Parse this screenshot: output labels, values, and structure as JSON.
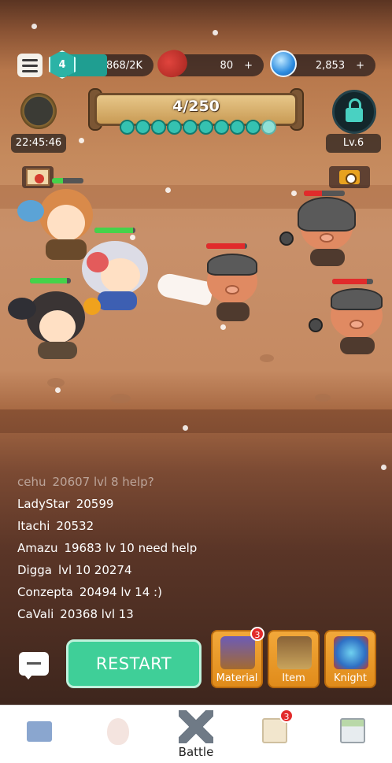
{
  "resources": {
    "player_level": "4",
    "xp": "868/2K",
    "meat": "80",
    "meat_plus": "+",
    "potion": "2,853",
    "potion_plus": "+"
  },
  "timer": "22:45:46",
  "wave": {
    "progress_text": "4/250",
    "enemy_icons_total": 10,
    "enemy_icons_remaining": 9
  },
  "stage_level": "Lv.6",
  "chat": [
    {
      "name": "cehu",
      "text": "20607 lvl 8 help?"
    },
    {
      "name": "LadyStar",
      "text": "20599"
    },
    {
      "name": "Itachi",
      "text": "20532"
    },
    {
      "name": "Amazu",
      "text": "19683 lv 10 need help"
    },
    {
      "name": "Digga",
      "text": "lvl 10 20274"
    },
    {
      "name": "Conzepta",
      "text": "20494 lv 14 :)"
    },
    {
      "name": "CaVali",
      "text": "20368 lvl 13"
    }
  ],
  "restart_label": "RESTART",
  "shop": {
    "material": {
      "label": "Material",
      "badge": "3"
    },
    "item": {
      "label": "Item"
    },
    "knight": {
      "label": "Knight"
    }
  },
  "nav": {
    "battle_label": "Battle",
    "quest_badge": "3"
  },
  "health": {
    "hero_top": 0.35,
    "hero_mid": 0.95,
    "hero_bottom": 0.9,
    "enemy_1": 0.95,
    "enemy_2": 0.45,
    "enemy_3": 0.85
  },
  "colors": {
    "accent_green": "#3fcf98",
    "teal": "#2bb3a6",
    "hp_green": "#45d24a",
    "hp_red": "#e12b2b"
  }
}
